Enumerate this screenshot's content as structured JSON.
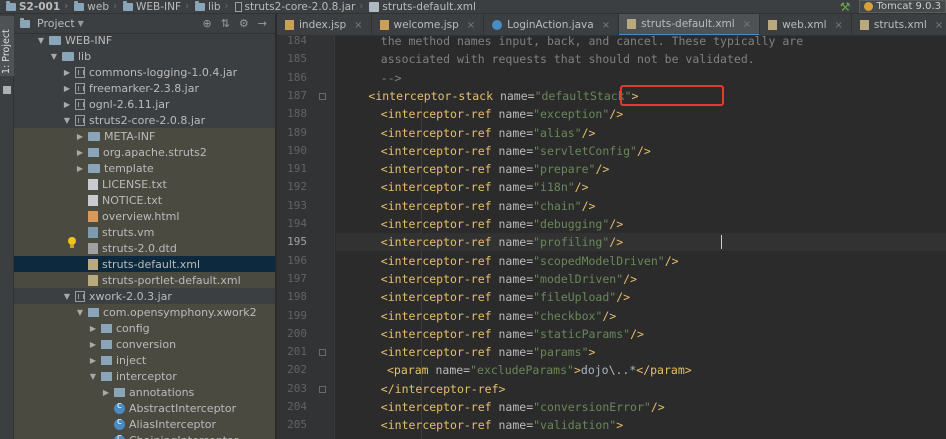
{
  "breadcrumbs": [
    {
      "label": "S2-001",
      "icon": "folder"
    },
    {
      "label": "web",
      "icon": "folder"
    },
    {
      "label": "WEB-INF",
      "icon": "folder"
    },
    {
      "label": "lib",
      "icon": "folder"
    },
    {
      "label": "struts2-core-2.0.8.jar",
      "icon": "jar"
    },
    {
      "label": "struts-default.xml",
      "icon": "xml"
    }
  ],
  "run_config": "Tomcat 9.0.3",
  "toolwindow_tab": "1: Project",
  "project_panel": {
    "title": "Project",
    "tree": [
      {
        "label": "WEB-INF",
        "icon": "folder",
        "depth": 2,
        "arrow": "open",
        "state": ""
      },
      {
        "label": "lib",
        "icon": "folder",
        "depth": 3,
        "arrow": "open",
        "state": ""
      },
      {
        "label": "commons-logging-1.0.4.jar",
        "icon": "jar",
        "depth": 4,
        "arrow": "closed",
        "state": ""
      },
      {
        "label": "freemarker-2.3.8.jar",
        "icon": "jar",
        "depth": 4,
        "arrow": "closed",
        "state": ""
      },
      {
        "label": "ognl-2.6.11.jar",
        "icon": "jar",
        "depth": 4,
        "arrow": "closed",
        "state": ""
      },
      {
        "label": "struts2-core-2.0.8.jar",
        "icon": "jar",
        "depth": 4,
        "arrow": "open",
        "state": ""
      },
      {
        "label": "META-INF",
        "icon": "folder",
        "depth": 5,
        "arrow": "closed",
        "state": "hl"
      },
      {
        "label": "org.apache.struts2",
        "icon": "pkg",
        "depth": 5,
        "arrow": "closed",
        "state": "hl"
      },
      {
        "label": "template",
        "icon": "folder",
        "depth": 5,
        "arrow": "closed",
        "state": "hl"
      },
      {
        "label": "LICENSE.txt",
        "icon": "file",
        "depth": 5,
        "arrow": "",
        "state": "hl"
      },
      {
        "label": "NOTICE.txt",
        "icon": "file",
        "depth": 5,
        "arrow": "",
        "state": "hl"
      },
      {
        "label": "overview.html",
        "icon": "html",
        "depth": 5,
        "arrow": "",
        "state": "hl"
      },
      {
        "label": "struts.vm",
        "icon": "vm",
        "depth": 5,
        "arrow": "",
        "state": "hl"
      },
      {
        "label": "struts-2.0.dtd",
        "icon": "dtd",
        "depth": 5,
        "arrow": "",
        "state": "hl"
      },
      {
        "label": "struts-default.xml",
        "icon": "xml",
        "depth": 5,
        "arrow": "",
        "state": "sel"
      },
      {
        "label": "struts-portlet-default.xml",
        "icon": "xml",
        "depth": 5,
        "arrow": "",
        "state": "hl"
      },
      {
        "label": "xwork-2.0.3.jar",
        "icon": "jar",
        "depth": 4,
        "arrow": "open",
        "state": ""
      },
      {
        "label": "com.opensymphony.xwork2",
        "icon": "pkg",
        "depth": 5,
        "arrow": "open",
        "state": "hl"
      },
      {
        "label": "config",
        "icon": "pkg",
        "depth": 6,
        "arrow": "closed",
        "state": "hl"
      },
      {
        "label": "conversion",
        "icon": "pkg",
        "depth": 6,
        "arrow": "closed",
        "state": "hl"
      },
      {
        "label": "inject",
        "icon": "pkg",
        "depth": 6,
        "arrow": "closed",
        "state": "hl"
      },
      {
        "label": "interceptor",
        "icon": "pkg",
        "depth": 6,
        "arrow": "open",
        "state": "hl"
      },
      {
        "label": "annotations",
        "icon": "pkg",
        "depth": 7,
        "arrow": "closed",
        "state": "hl"
      },
      {
        "label": "AbstractInterceptor",
        "icon": "cls",
        "depth": 7,
        "arrow": "",
        "state": "hl"
      },
      {
        "label": "AliasInterceptor",
        "icon": "cls",
        "depth": 7,
        "arrow": "",
        "state": "hl"
      },
      {
        "label": "ChainingInterceptor",
        "icon": "cls",
        "depth": 7,
        "arrow": "",
        "state": "hl"
      }
    ]
  },
  "tabs": [
    {
      "label": "index.jsp",
      "icon": "jsp",
      "active": false
    },
    {
      "label": "welcome.jsp",
      "icon": "jsp",
      "active": false
    },
    {
      "label": "LoginAction.java",
      "icon": "java",
      "active": false
    },
    {
      "label": "struts-default.xml",
      "icon": "xml",
      "active": true
    },
    {
      "label": "web.xml",
      "icon": "xml",
      "active": false
    },
    {
      "label": "struts.xml",
      "icon": "xml",
      "active": false
    }
  ],
  "editor": {
    "current_line": 195,
    "lines": [
      {
        "n": 184,
        "indent": 8,
        "parts": [
          {
            "t": "the method names input, back, and cancel. These typically are",
            "c": "cmt"
          }
        ]
      },
      {
        "n": 185,
        "indent": 8,
        "parts": [
          {
            "t": "associated with requests that should not be validated.",
            "c": "cmt"
          }
        ]
      },
      {
        "n": 186,
        "indent": 8,
        "parts": [
          {
            "t": "-->",
            "c": "cmt"
          }
        ]
      },
      {
        "n": 187,
        "indent": 4,
        "parts": [
          {
            "t": "<interceptor-stack ",
            "c": "tag"
          },
          {
            "t": "name=",
            "c": "attr"
          },
          {
            "t": "\"defaultStack\"",
            "c": "val"
          },
          {
            "t": ">",
            "c": "tag"
          }
        ]
      },
      {
        "n": 188,
        "indent": 8,
        "parts": [
          {
            "t": "<interceptor-ref ",
            "c": "tag"
          },
          {
            "t": "name=",
            "c": "attr"
          },
          {
            "t": "\"exception\"",
            "c": "val"
          },
          {
            "t": "/>",
            "c": "tag"
          }
        ]
      },
      {
        "n": 189,
        "indent": 8,
        "parts": [
          {
            "t": "<interceptor-ref ",
            "c": "tag"
          },
          {
            "t": "name=",
            "c": "attr"
          },
          {
            "t": "\"alias\"",
            "c": "val"
          },
          {
            "t": "/>",
            "c": "tag"
          }
        ]
      },
      {
        "n": 190,
        "indent": 8,
        "parts": [
          {
            "t": "<interceptor-ref ",
            "c": "tag"
          },
          {
            "t": "name=",
            "c": "attr"
          },
          {
            "t": "\"servletConfig\"",
            "c": "val"
          },
          {
            "t": "/>",
            "c": "tag"
          }
        ]
      },
      {
        "n": 191,
        "indent": 8,
        "parts": [
          {
            "t": "<interceptor-ref ",
            "c": "tag"
          },
          {
            "t": "name=",
            "c": "attr"
          },
          {
            "t": "\"prepare\"",
            "c": "val"
          },
          {
            "t": "/>",
            "c": "tag"
          }
        ]
      },
      {
        "n": 192,
        "indent": 8,
        "parts": [
          {
            "t": "<interceptor-ref ",
            "c": "tag"
          },
          {
            "t": "name=",
            "c": "attr"
          },
          {
            "t": "\"i18n\"",
            "c": "val"
          },
          {
            "t": "/>",
            "c": "tag"
          }
        ]
      },
      {
        "n": 193,
        "indent": 8,
        "parts": [
          {
            "t": "<interceptor-ref ",
            "c": "tag"
          },
          {
            "t": "name=",
            "c": "attr"
          },
          {
            "t": "\"chain\"",
            "c": "val"
          },
          {
            "t": "/>",
            "c": "tag"
          }
        ]
      },
      {
        "n": 194,
        "indent": 8,
        "parts": [
          {
            "t": "<interceptor-ref ",
            "c": "tag"
          },
          {
            "t": "name=",
            "c": "attr"
          },
          {
            "t": "\"debugging\"",
            "c": "val"
          },
          {
            "t": "/>",
            "c": "tag"
          }
        ]
      },
      {
        "n": 195,
        "indent": 8,
        "parts": [
          {
            "t": "<interceptor-ref ",
            "c": "tag"
          },
          {
            "t": "name=",
            "c": "attr"
          },
          {
            "t": "\"profiling\"",
            "c": "val"
          },
          {
            "t": "/>",
            "c": "tag"
          }
        ]
      },
      {
        "n": 196,
        "indent": 8,
        "parts": [
          {
            "t": "<interceptor-ref ",
            "c": "tag"
          },
          {
            "t": "name=",
            "c": "attr"
          },
          {
            "t": "\"scopedModelDriven\"",
            "c": "val"
          },
          {
            "t": "/>",
            "c": "tag"
          }
        ]
      },
      {
        "n": 197,
        "indent": 8,
        "parts": [
          {
            "t": "<interceptor-ref ",
            "c": "tag"
          },
          {
            "t": "name=",
            "c": "attr"
          },
          {
            "t": "\"modelDriven\"",
            "c": "val"
          },
          {
            "t": "/>",
            "c": "tag"
          }
        ]
      },
      {
        "n": 198,
        "indent": 8,
        "parts": [
          {
            "t": "<interceptor-ref ",
            "c": "tag"
          },
          {
            "t": "name=",
            "c": "attr"
          },
          {
            "t": "\"fileUpload\"",
            "c": "val"
          },
          {
            "t": "/>",
            "c": "tag"
          }
        ]
      },
      {
        "n": 199,
        "indent": 8,
        "parts": [
          {
            "t": "<interceptor-ref ",
            "c": "tag"
          },
          {
            "t": "name=",
            "c": "attr"
          },
          {
            "t": "\"checkbox\"",
            "c": "val"
          },
          {
            "t": "/>",
            "c": "tag"
          }
        ]
      },
      {
        "n": 200,
        "indent": 8,
        "parts": [
          {
            "t": "<interceptor-ref ",
            "c": "tag"
          },
          {
            "t": "name=",
            "c": "attr"
          },
          {
            "t": "\"staticParams\"",
            "c": "val"
          },
          {
            "t": "/>",
            "c": "tag"
          }
        ]
      },
      {
        "n": 201,
        "indent": 8,
        "parts": [
          {
            "t": "<interceptor-ref ",
            "c": "tag"
          },
          {
            "t": "name=",
            "c": "attr"
          },
          {
            "t": "\"params\"",
            "c": "val"
          },
          {
            "t": ">",
            "c": "tag"
          }
        ]
      },
      {
        "n": 202,
        "indent": 10,
        "parts": [
          {
            "t": "<param ",
            "c": "tag"
          },
          {
            "t": "name=",
            "c": "attr"
          },
          {
            "t": "\"excludeParams\"",
            "c": "val"
          },
          {
            "t": ">",
            "c": "tag"
          },
          {
            "t": "dojo\\..*",
            "c": "txt"
          },
          {
            "t": "</param>",
            "c": "tag"
          }
        ]
      },
      {
        "n": 203,
        "indent": 8,
        "parts": [
          {
            "t": "</interceptor-ref>",
            "c": "tag"
          }
        ]
      },
      {
        "n": 204,
        "indent": 8,
        "parts": [
          {
            "t": "<interceptor-ref ",
            "c": "tag"
          },
          {
            "t": "name=",
            "c": "attr"
          },
          {
            "t": "\"conversionError\"",
            "c": "val"
          },
          {
            "t": "/>",
            "c": "tag"
          }
        ]
      },
      {
        "n": 205,
        "indent": 8,
        "parts": [
          {
            "t": "<interceptor-ref ",
            "c": "tag"
          },
          {
            "t": "name=",
            "c": "attr"
          },
          {
            "t": "\"validation\"",
            "c": "val"
          },
          {
            "t": ">",
            "c": "tag"
          }
        ]
      }
    ]
  },
  "colors": {
    "highlight_box": "#e03c31",
    "tag": "#e8bf6a",
    "value": "#6a8759",
    "comment": "#808080"
  }
}
